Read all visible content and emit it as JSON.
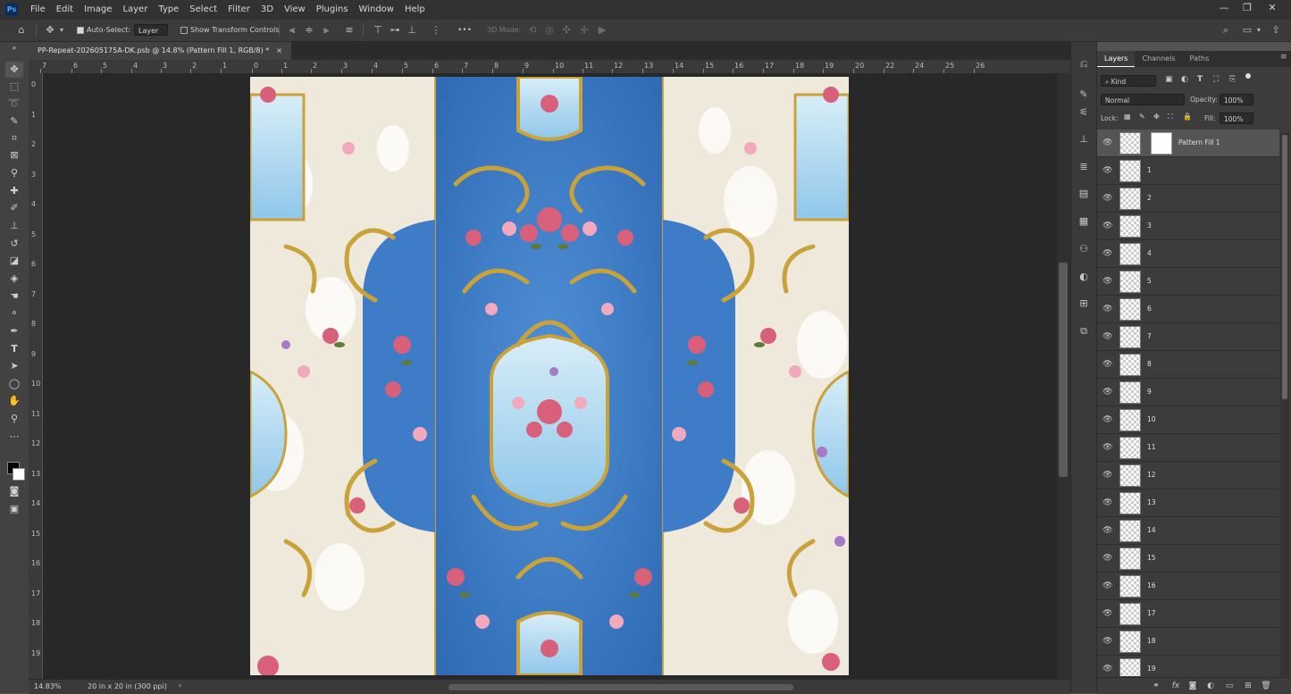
{
  "app": {
    "logo": "Ps"
  },
  "menu": [
    "File",
    "Edit",
    "Image",
    "Layer",
    "Type",
    "Select",
    "Filter",
    "3D",
    "View",
    "Plugins",
    "Window",
    "Help"
  ],
  "window_controls": {
    "minimize": "—",
    "restore": "❐",
    "close": "✕"
  },
  "options_bar": {
    "auto_select_label": "Auto-Select:",
    "auto_select_checked": true,
    "auto_select_target": "Layer",
    "show_transform_label": "Show Transform Controls",
    "show_transform_checked": false,
    "three_d_mode_label": "3D Mode:",
    "more_glyph": "•••"
  },
  "document_tab": {
    "title": "PP-Repeat-202605175A-DK.psb @ 14.8% (Pattern Fill 1, RGB/8) *",
    "close": "×"
  },
  "ruler": {
    "horizontal_labels": [
      "7",
      "6",
      "5",
      "4",
      "3",
      "2",
      "1",
      "0",
      "1",
      "2",
      "3",
      "4",
      "5",
      "6",
      "7",
      "8",
      "9",
      "10",
      "11",
      "12",
      "13",
      "14",
      "15",
      "16",
      "17",
      "18",
      "19",
      "20",
      "22",
      "24",
      "25",
      "26"
    ],
    "vertical_labels": [
      "0",
      "1",
      "2",
      "3",
      "4",
      "5",
      "6",
      "7",
      "8",
      "9",
      "10",
      "11",
      "12",
      "13",
      "14",
      "15",
      "16",
      "17",
      "18",
      "19"
    ]
  },
  "status_bar": {
    "zoom": "14.83%",
    "doc_info": "20 in x 20 in (300 ppi)",
    "arrow": "›"
  },
  "panels": {
    "tabs": [
      "Layers",
      "Channels",
      "Paths"
    ],
    "active_tab": "Layers",
    "filter_kind": "Kind",
    "blend_mode": "Normal",
    "opacity_label": "Opacity:",
    "opacity_value": "100%",
    "lock_label": "Lock:",
    "fill_label": "Fill:",
    "fill_value": "100%"
  },
  "layers": [
    {
      "name": "Pattern Fill 1",
      "selected": true,
      "has_mask": true
    },
    {
      "name": "1"
    },
    {
      "name": "2"
    },
    {
      "name": "3"
    },
    {
      "name": "4"
    },
    {
      "name": "5"
    },
    {
      "name": "6"
    },
    {
      "name": "7"
    },
    {
      "name": "8"
    },
    {
      "name": "9"
    },
    {
      "name": "10"
    },
    {
      "name": "11"
    },
    {
      "name": "12"
    },
    {
      "name": "13"
    },
    {
      "name": "14"
    },
    {
      "name": "15"
    },
    {
      "name": "16"
    },
    {
      "name": "17"
    },
    {
      "name": "18"
    },
    {
      "name": "19"
    }
  ],
  "colors": {
    "accent_blue": "#3b7bc4",
    "light_blue": "#bfe0f2",
    "cream": "#efe9dc",
    "gold": "#c9a23a",
    "rose": "#d9607a"
  }
}
